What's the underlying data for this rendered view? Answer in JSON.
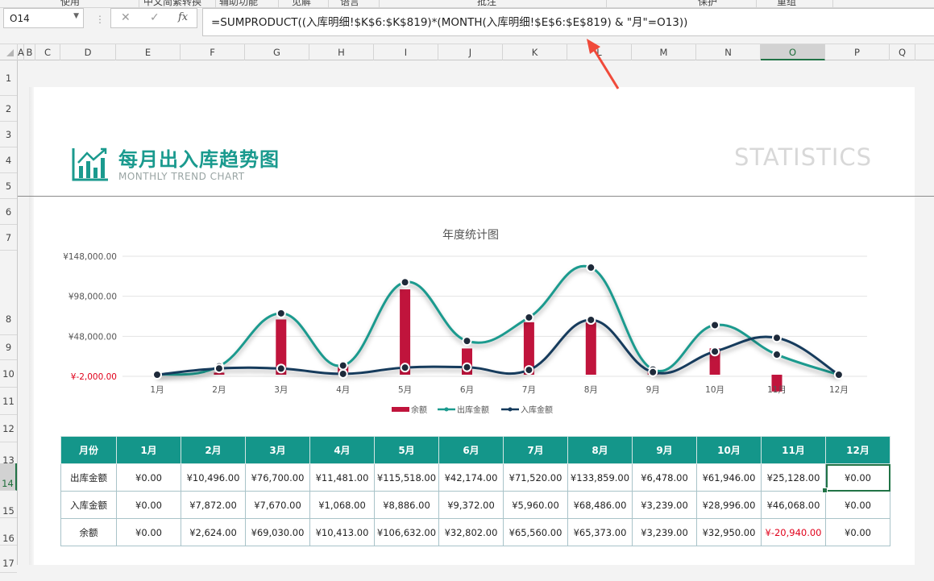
{
  "ribbon": {
    "labels": [
      "使用",
      "中文简繁转换",
      "辅助功能",
      "见解",
      "语言",
      "批注",
      "保护",
      "重组"
    ]
  },
  "formula_bar": {
    "name_box": "O14",
    "cancel_glyph": "✕",
    "enter_glyph": "✓",
    "fx_glyph": "fx",
    "formula": "=SUMPRODUCT((入库明细!$K$6:$K$819)*(MONTH(入库明细!$E$6:$E$819) & \"月\"=O13))"
  },
  "columns": [
    "A",
    "B",
    "C",
    "D",
    "E",
    "F",
    "G",
    "H",
    "I",
    "J",
    "K",
    "L",
    "M",
    "N",
    "O",
    "P",
    "Q"
  ],
  "selected_column": "O",
  "rows": [
    "1",
    "2",
    "3",
    "4",
    "5",
    "6",
    "7",
    "8",
    "9",
    "10",
    "11",
    "12",
    "13",
    "14",
    "15",
    "16",
    "17"
  ],
  "selected_row": "14",
  "header": {
    "title_cn": "每月出入库趋势图",
    "title_en": "MONTHLY TREND CHART",
    "right_text": "STATISTICS",
    "accent": "#1a9a8e"
  },
  "chart_data": {
    "type": "line",
    "title": "年度统计图",
    "categories": [
      "1月",
      "2月",
      "3月",
      "4月",
      "5月",
      "6月",
      "7月",
      "8月",
      "9月",
      "10月",
      "11月",
      "12月"
    ],
    "yticks": [
      "¥148,000.00",
      "¥98,000.00",
      "¥48,000.00",
      "¥-2,000.00"
    ],
    "ylim": [
      -2000,
      148000
    ],
    "series": [
      {
        "name": "余额",
        "kind": "bar",
        "color": "#c0143c",
        "values": [
          0,
          2624,
          69030,
          10413,
          106632,
          32802,
          65560,
          65373,
          3239,
          32950,
          -20940,
          0
        ]
      },
      {
        "name": "出库金额",
        "kind": "line",
        "color": "#1a9a8e",
        "values": [
          0,
          10496,
          76700,
          11481,
          115518,
          42174,
          71520,
          133859,
          6478,
          61946,
          25128,
          0
        ]
      },
      {
        "name": "入库金额",
        "kind": "line",
        "color": "#143a5c",
        "values": [
          0,
          7872,
          7670,
          1068,
          8886,
          9372,
          5960,
          68486,
          3239,
          28996,
          46068,
          0
        ]
      }
    ],
    "legend_position": "bottom",
    "grid": true
  },
  "table": {
    "header": [
      "月份",
      "1月",
      "2月",
      "3月",
      "4月",
      "5月",
      "6月",
      "7月",
      "8月",
      "9月",
      "10月",
      "11月",
      "12月"
    ],
    "rows": [
      [
        "出库金额",
        "¥0.00",
        "¥10,496.00",
        "¥76,700.00",
        "¥11,481.00",
        "¥115,518.00",
        "¥42,174.00",
        "¥71,520.00",
        "¥133,859.00",
        "¥6,478.00",
        "¥61,946.00",
        "¥25,128.00",
        "¥0.00"
      ],
      [
        "入库金额",
        "¥0.00",
        "¥7,872.00",
        "¥7,670.00",
        "¥1,068.00",
        "¥8,886.00",
        "¥9,372.00",
        "¥5,960.00",
        "¥68,486.00",
        "¥3,239.00",
        "¥28,996.00",
        "¥46,068.00",
        "¥0.00"
      ],
      [
        "余额",
        "¥0.00",
        "¥2,624.00",
        "¥69,030.00",
        "¥10,413.00",
        "¥106,632.00",
        "¥32,802.00",
        "¥65,560.00",
        "¥65,373.00",
        "¥3,239.00",
        "¥32,950.00",
        "¥-20,940.00",
        "¥0.00"
      ]
    ],
    "negative_color": "#e0001a",
    "active_cell": [
      0,
      11
    ]
  }
}
